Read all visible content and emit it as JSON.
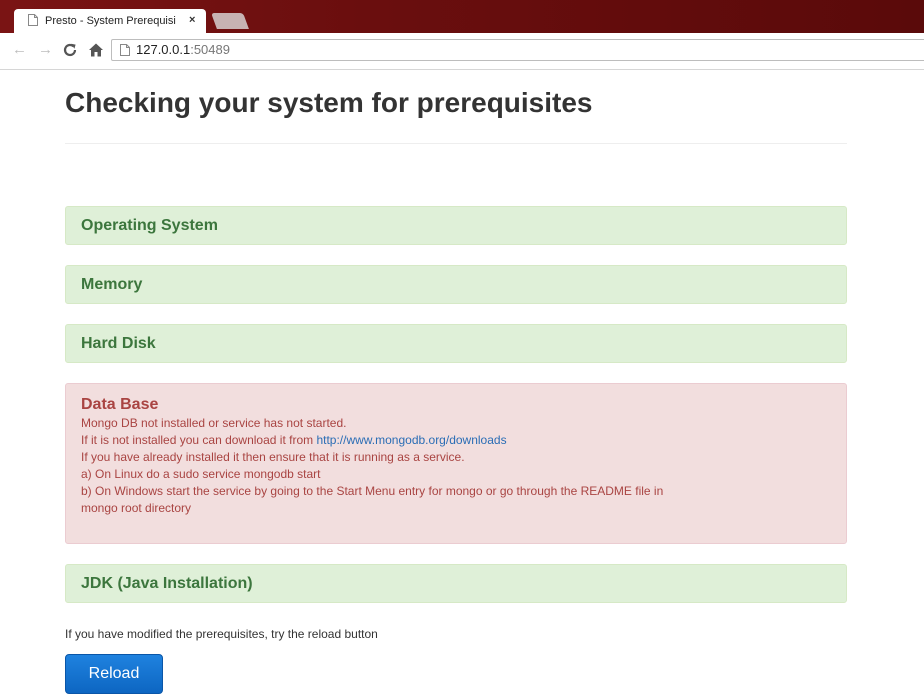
{
  "browser": {
    "tab_title": "Presto - System Prerequisi",
    "tab_close": "×",
    "url_host": "127.0.0.1",
    "url_port": ":50489",
    "icons": {
      "back": "back-arrow-icon",
      "forward": "forward-arrow-icon",
      "reload": "reload-icon",
      "home": "home-icon"
    }
  },
  "page": {
    "title": "Checking your system for prerequisites",
    "checks": [
      {
        "label": "Operating System",
        "status": "ok"
      },
      {
        "label": "Memory",
        "status": "ok"
      },
      {
        "label": "Hard Disk",
        "status": "ok"
      },
      {
        "label": "Data Base",
        "status": "error",
        "lines": [
          "Mongo DB not installed or service has not started.",
          "If it is not installed you can download it from ",
          "If you have already installed it then ensure that it is running as a service.",
          "a) On Linux do a sudo service mongodb start",
          "b) On Windows start the service by going to the Start Menu entry for mongo or go through the README file in",
          "mongo root directory"
        ],
        "link_text": "http://www.mongodb.org/downloads"
      },
      {
        "label": "JDK (Java Installation)",
        "status": "ok"
      }
    ],
    "note": "If you have modified the prerequisites, try the reload button",
    "reload_label": "Reload"
  },
  "colors": {
    "ok_bg": "#dff0d8",
    "ok_text": "#3c763d",
    "error_bg": "#f2dede",
    "error_text": "#a94442",
    "button": "#1373d0",
    "tabstrip": "#6a0e0e"
  }
}
